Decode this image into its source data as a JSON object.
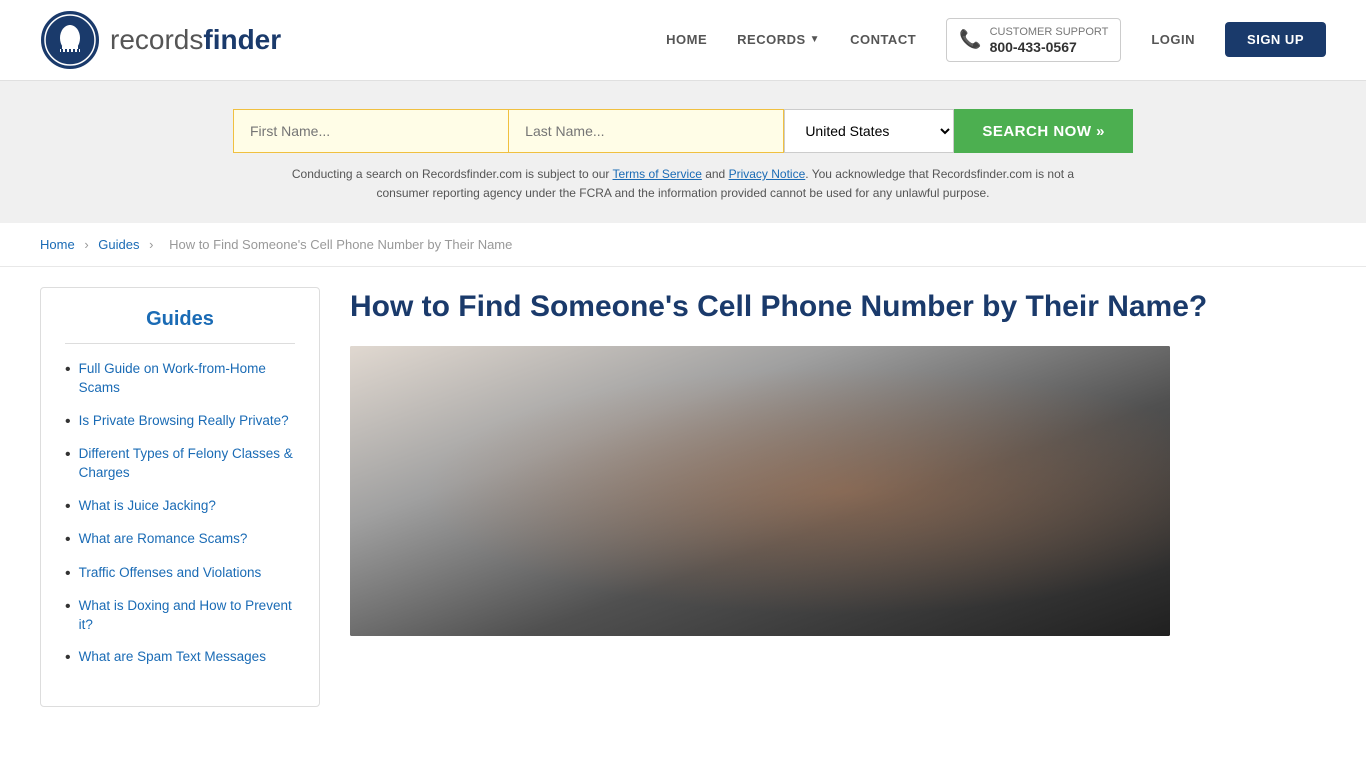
{
  "header": {
    "logo_text_light": "records",
    "logo_text_bold": "finder",
    "nav": {
      "home": "HOME",
      "records": "RECORDS",
      "contact": "CONTACT",
      "support_label": "CUSTOMER SUPPORT",
      "support_phone": "800-433-0567",
      "login": "LOGIN",
      "signup": "SIGN UP"
    }
  },
  "search": {
    "first_name_placeholder": "First Name...",
    "last_name_placeholder": "Last Name...",
    "country": "United States",
    "search_button": "SEARCH NOW »",
    "notice": "Conducting a search on Recordsfinder.com is subject to our Terms of Service and Privacy Notice. You acknowledge that Recordsfinder.com is not a consumer reporting agency under the FCRA and the information provided cannot be used for any unlawful purpose.",
    "terms_link": "Terms of Service",
    "privacy_link": "Privacy Notice"
  },
  "breadcrumb": {
    "home": "Home",
    "guides": "Guides",
    "current": "How to Find Someone's Cell Phone Number by Their Name"
  },
  "sidebar": {
    "title": "Guides",
    "items": [
      {
        "label": "Full Guide on Work-from-Home Scams"
      },
      {
        "label": "Is Private Browsing Really Private?"
      },
      {
        "label": "Different Types of Felony Classes & Charges"
      },
      {
        "label": "What is Juice Jacking?"
      },
      {
        "label": "What are Romance Scams?"
      },
      {
        "label": "Traffic Offenses and Violations"
      },
      {
        "label": "What is Doxing and How to Prevent it?"
      },
      {
        "label": "What are Spam Text Messages"
      }
    ]
  },
  "article": {
    "title": "How to Find Someone's Cell Phone Number by Their Name?"
  }
}
